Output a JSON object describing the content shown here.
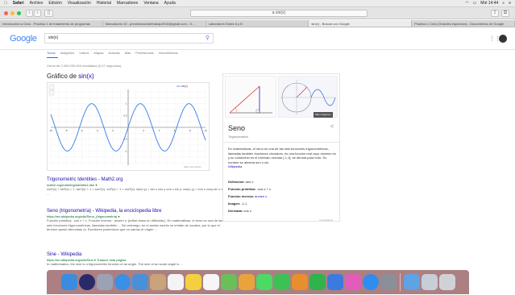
{
  "menubar": {
    "apple": "",
    "items": [
      "Safari",
      "Archivo",
      "Edición",
      "Visualización",
      "Historial",
      "Marcadores",
      "Ventana",
      "Ayuda"
    ],
    "clock": "Mié 14:44"
  },
  "toolbar": {
    "back": "‹",
    "forward": "›",
    "address": "a sin(x)"
  },
  "tabs": [
    "Introducción a Ciclo - Practica 1 de tratamiento de programas",
    "Marcadores 10 - presentaciondetrabajo2016@gmail.com - G...",
    "Laboratorio Sobre A y B",
    "sin(x) - Buscar con Google",
    "Practica 1 Ciclo (Grandes espectros) - Documentos de Google"
  ],
  "google": {
    "logo": "Google",
    "query": "sin(x)",
    "tabs": [
      "Todos",
      "Imágenes",
      "Videos",
      "Mapas",
      "Noticias",
      "Más",
      "Preferencias",
      "Herramientas"
    ],
    "stats": "Cerca de 2.900.000.000 resultados (0,47 segundos)",
    "graph_title_prefix": "Gráfico de ",
    "graph_title_fn": "sin(x)",
    "graph_legend": "sin(x)",
    "graph_note": "Más información"
  },
  "chart_data": {
    "type": "line",
    "title": "Gráfico de sin(x)",
    "function": "sin(x)",
    "xlim": [
      -10,
      10
    ],
    "ylim": [
      -1.6,
      1.6
    ],
    "xticks": [
      -10,
      -8,
      -6,
      -4,
      -2,
      2,
      4,
      6,
      8,
      10
    ],
    "yticks": [
      1,
      0.5,
      -0.5,
      -1
    ],
    "grid": true,
    "line_color": "#4a86e8",
    "legend": "top-right"
  },
  "results": [
    {
      "title": "Trigonometric Identities - Math2.org",
      "url": "math2.org/math/trig/identities.htm ▾",
      "snippet": "cos²(x) + sin²(x) = 1. tan²(x) + 1 = sec²(x). cot²(x) + 1 = csc²(x). sin(x y) = sin x cos y cos x sin y. cos(x y) = cos x cosy sin x sin y ..."
    },
    {
      "title": "Seno (trigonometría) - Wikipedia, la enciclopedia libre",
      "url": "https://es.wikipedia.org/wiki/Seno_(trigonometría) ▾",
      "snippet": "Función primitiva, -cos x + c. Función inversa · arcsen x; [editar datos en Wikidata ]. En matemáticas, el seno es una de las seis funciones trigonométricas, llamadas también ... Sin embargo, en el anotar escrito se emitan de vocales, por lo que el término quedó abreviado (s. Escritores posteriores que no sabían el origen ..."
    },
    {
      "title": "Sine - Wikipedia",
      "url": "https://en.wikipedia.org/wiki/Sine ▾ Traducir esta página",
      "snippet": "In mathematics, the sine is a trigonometric function of an angle. The sine of an acute angle is ..."
    }
  ],
  "knowledge": {
    "more_images": "Más imágenes",
    "title": "Seno",
    "subtitle": "Trigonometría",
    "share": "<",
    "description": "En matemáticas, el seno es una de las seis funciones trigonométricas, llamadas también funciones circulares, es una función real cuyo dominio es y su codominio es el intervalo cerrado [-1,1]; se denota para todo. Su nombre se abrevia sen o sin.",
    "wiki": "Wikipedia",
    "rows": [
      {
        "label": "Definición:",
        "value": "sen x"
      },
      {
        "label": "Función primitiva:",
        "value": "-cos x + c"
      },
      {
        "label": "Función inversa:",
        "value": "arcsen x"
      },
      {
        "label": "Imagen:",
        "value": "-1,1"
      },
      {
        "label": "Derivada:",
        "value": "cos x"
      }
    ],
    "comments": "Comentarios"
  },
  "dock": {
    "icons": [
      {
        "name": "finder-icon",
        "color": "#3b8be0"
      },
      {
        "name": "siri-icon",
        "color": "#2a2a6a"
      },
      {
        "name": "launchpad-icon",
        "color": "#9aa3b5"
      },
      {
        "name": "safari-icon",
        "color": "#3a8fe6"
      },
      {
        "name": "mail-icon",
        "color": "#4a90d9"
      },
      {
        "name": "contacts-icon",
        "color": "#c9a37a"
      },
      {
        "name": "calendar-icon",
        "color": "#f4f4f4"
      },
      {
        "name": "notes-icon",
        "color": "#f4d03f"
      },
      {
        "name": "reminders-icon",
        "color": "#f6f6f6"
      },
      {
        "name": "maps-icon",
        "color": "#6bbf59"
      },
      {
        "name": "photos-icon",
        "color": "#e8a33d"
      },
      {
        "name": "messages-icon",
        "color": "#4cd964"
      },
      {
        "name": "facetime-icon",
        "color": "#3cc155"
      },
      {
        "name": "pages-icon",
        "color": "#e88e2c"
      },
      {
        "name": "numbers-icon",
        "color": "#2fb34a"
      },
      {
        "name": "keynote-icon",
        "color": "#3d7ae0"
      },
      {
        "name": "itunes-icon",
        "color": "#e25dbb"
      },
      {
        "name": "appstore-icon",
        "color": "#2e8ef0"
      },
      {
        "name": "preferences-icon",
        "color": "#8a8f99"
      },
      {
        "name": "downloads-folder-icon",
        "color": "#5ea3e3"
      },
      {
        "name": "documents-icon",
        "color": "#c8ced8"
      },
      {
        "name": "trash-icon",
        "color": "#cfd3d8"
      }
    ]
  }
}
